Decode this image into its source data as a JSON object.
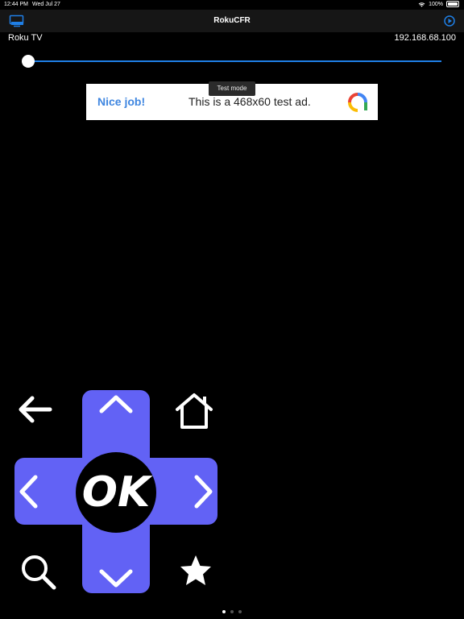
{
  "status_bar": {
    "time": "12:44 PM",
    "date": "Wed Jul 27",
    "battery": "100%"
  },
  "nav": {
    "title": "RokuCFR",
    "cast_icon": "tv-cast-icon",
    "settings_icon": "settings-icon"
  },
  "device": {
    "name": "Roku TV",
    "ip": "192.168.68.100"
  },
  "volume_slider": {
    "value": 0
  },
  "ad": {
    "headline": "Nice job!",
    "body": "This is a 468x60 test ad.",
    "test_mode_label": "Test mode"
  },
  "remote": {
    "ok_label": "OK",
    "icons": [
      "back-arrow-icon",
      "home-icon",
      "up-chevron-icon",
      "down-chevron-icon",
      "left-chevron-icon",
      "right-chevron-icon",
      "search-icon",
      "star-icon"
    ]
  },
  "colors": {
    "accent": "#1f7fe6",
    "dpad": "#6262f5",
    "ad_headline": "#3f86e0"
  },
  "page_indicator": {
    "count": 3,
    "active": 0
  }
}
